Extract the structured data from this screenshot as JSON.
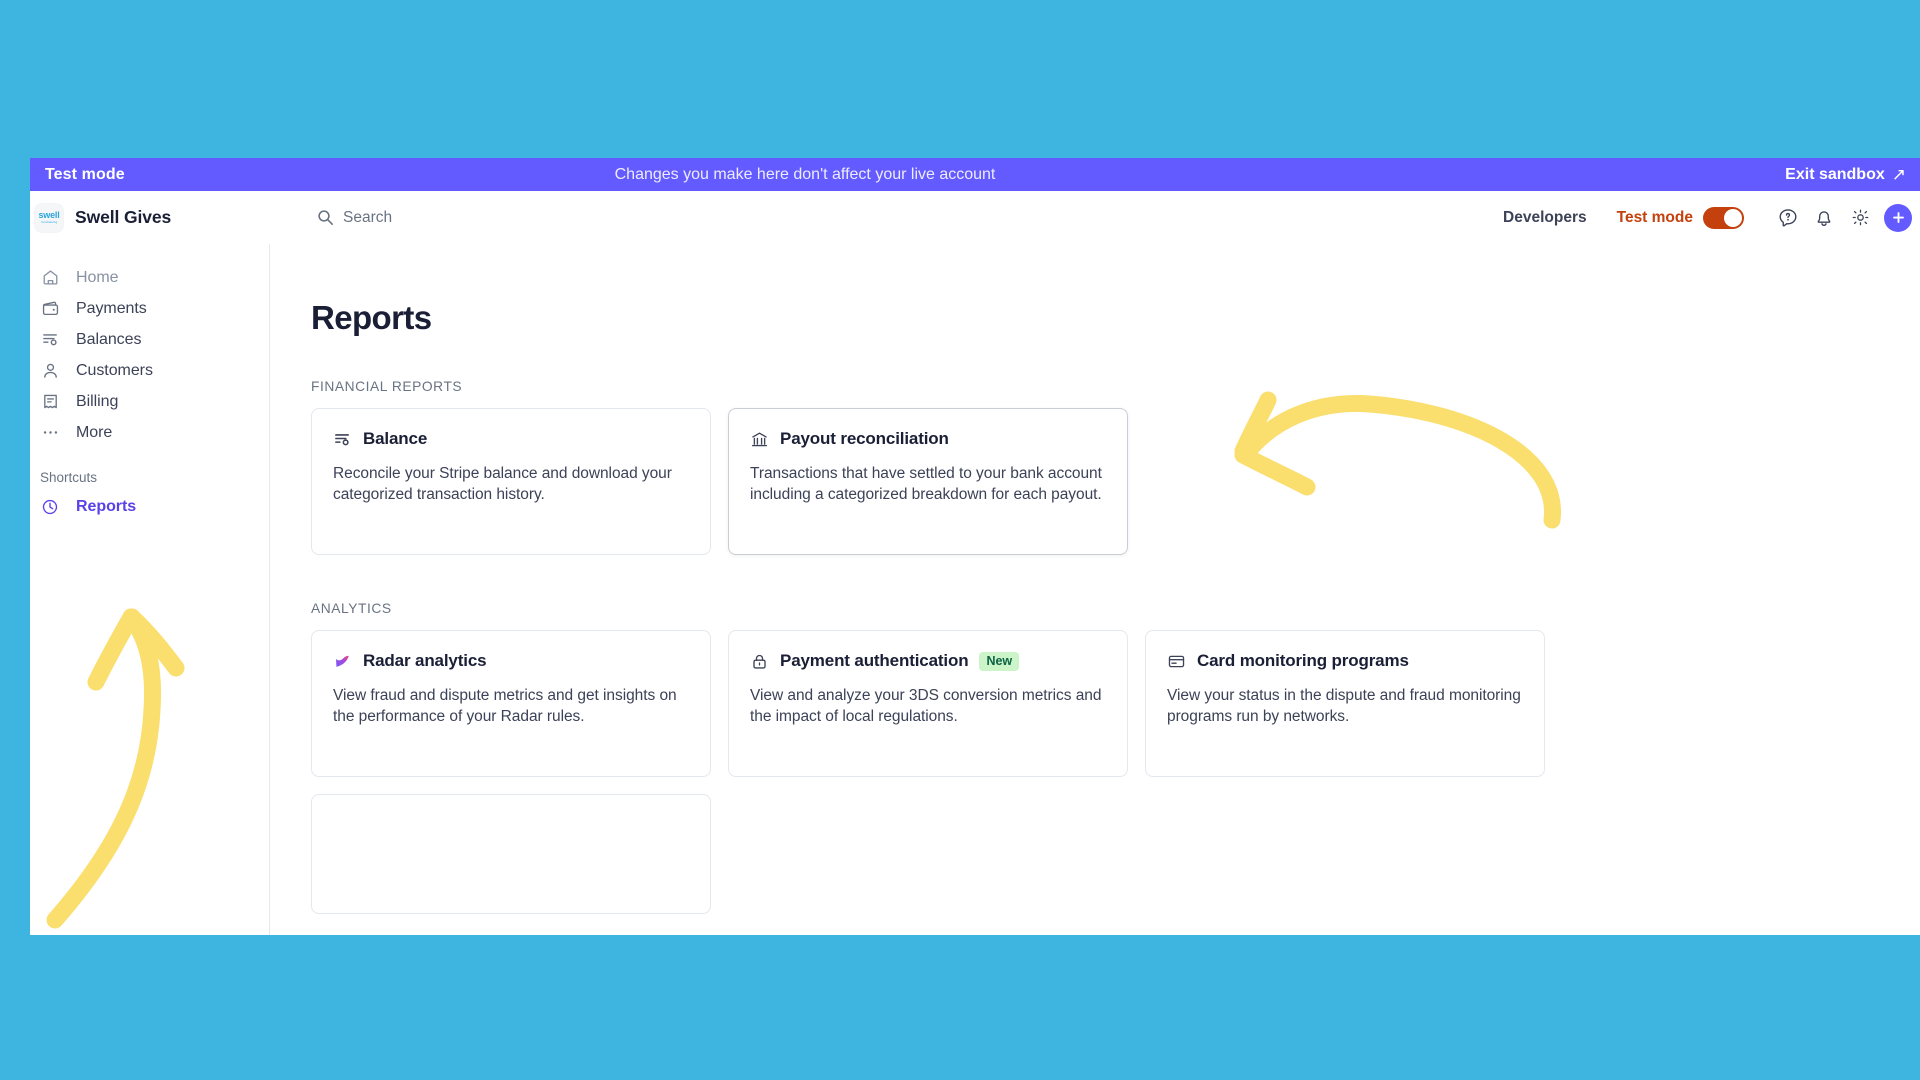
{
  "banner": {
    "label": "Test mode",
    "message": "Changes you make here don't affect your live account",
    "exit_label": "Exit sandbox",
    "exit_arrow": "↗",
    "bg_color": "#635BFF"
  },
  "header": {
    "logo_word": "swell",
    "logo_sub": "fundraising",
    "brand_name": "Swell Gives",
    "search_placeholder": "Search",
    "developers_label": "Developers",
    "test_mode_label": "Test mode",
    "test_mode_enabled": "on",
    "test_mode_color": "#C4410D",
    "icons": [
      "help-icon",
      "notifications-icon",
      "settings-icon",
      "create-icon"
    ],
    "plus_label": "+",
    "accent_color": "#635BFF"
  },
  "sidebar": {
    "items": [
      {
        "label": "Home",
        "icon": "home-icon",
        "state": "muted"
      },
      {
        "label": "Payments",
        "icon": "wallet-icon",
        "state": "default"
      },
      {
        "label": "Balances",
        "icon": "balances-icon",
        "state": "default"
      },
      {
        "label": "Customers",
        "icon": "person-icon",
        "state": "default"
      },
      {
        "label": "Billing",
        "icon": "invoice-icon",
        "state": "default"
      },
      {
        "label": "More",
        "icon": "ellipsis-icon",
        "state": "default"
      }
    ],
    "shortcuts_header": "Shortcuts",
    "shortcut": {
      "label": "Reports",
      "icon": "clock-icon",
      "color": "#5A41E8"
    }
  },
  "main": {
    "page_title": "Reports",
    "sections": [
      {
        "label": "FINANCIAL REPORTS",
        "cards": [
          {
            "title": "Balance",
            "icon": "balances-icon",
            "desc": "Reconcile your Stripe balance and download your categorized transaction history.",
            "badge": "",
            "highlighted": "no"
          },
          {
            "title": "Payout reconciliation",
            "icon": "bank-icon",
            "desc": "Transactions that have settled to your bank account including a categorized breakdown for each payout.",
            "badge": "",
            "highlighted": "yes"
          }
        ]
      },
      {
        "label": "ANALYTICS",
        "cards": [
          {
            "title": "Radar analytics",
            "icon": "radar-icon",
            "desc": "View fraud and dispute metrics and get insights on the performance of your Radar rules.",
            "badge": "",
            "highlighted": "no"
          },
          {
            "title": "Payment authentication",
            "icon": "lock-icon",
            "desc": "View and analyze your 3DS conversion metrics and the impact of local regulations.",
            "badge": "New",
            "highlighted": "no"
          },
          {
            "title": "Card monitoring programs",
            "icon": "card-icon",
            "desc": "View your status in the dispute and fraud monitoring programs run by networks.",
            "badge": "",
            "highlighted": "no"
          }
        ]
      }
    ]
  },
  "annotations": {
    "arrow_color": "#FADE6E",
    "arrows": [
      {
        "name": "arrow-to-payout-reconciliation",
        "points_at": "Payout reconciliation card"
      },
      {
        "name": "arrow-to-reports-shortcut",
        "points_at": "Reports shortcut in sidebar"
      }
    ]
  }
}
